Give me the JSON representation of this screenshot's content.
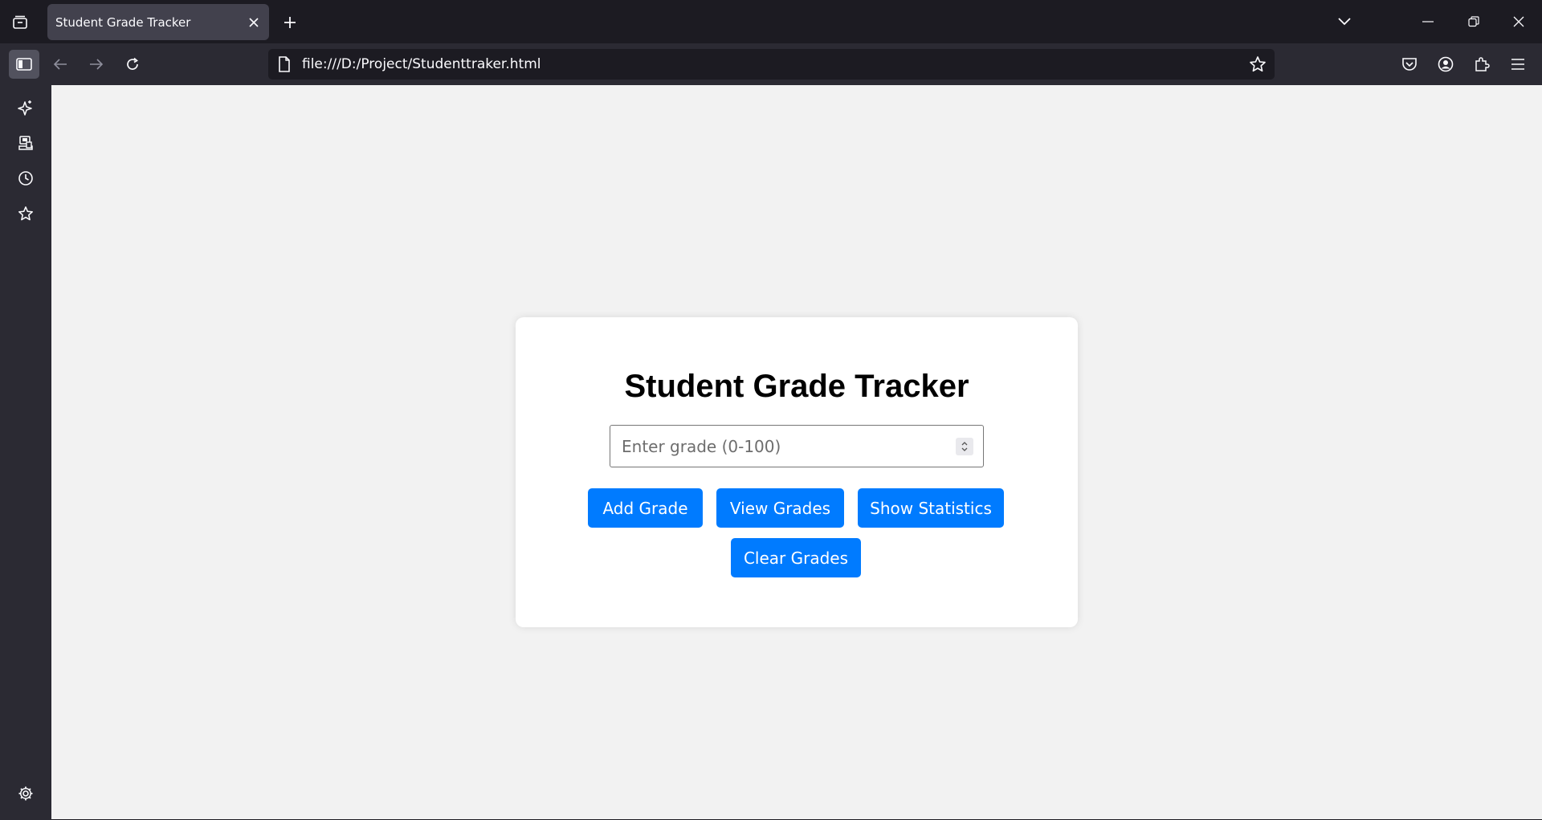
{
  "browser": {
    "tab_title": "Student Grade Tracker",
    "url": "file:///D:/Project/Studenttraker.html",
    "icons": {
      "tab_list": "tab-list-icon",
      "close_tab": "close-icon",
      "new_tab": "plus-icon",
      "list_all_tabs": "chevron-down-icon",
      "minimize": "minimize-icon",
      "restore": "restore-icon",
      "close_window": "close-icon",
      "sidebar": "sidebar-icon",
      "back": "back-arrow-icon",
      "forward": "forward-arrow-icon",
      "reload": "reload-icon",
      "page": "page-icon",
      "bookmark": "star-icon",
      "pocket": "pocket-icon",
      "account": "account-icon",
      "extensions": "puzzle-icon",
      "menu": "hamburger-menu-icon"
    }
  },
  "sidebar": {
    "items": [
      {
        "icon": "ai-sparkle-icon"
      },
      {
        "icon": "synced-tabs-icon"
      },
      {
        "icon": "history-icon"
      },
      {
        "icon": "bookmarks-star-icon"
      }
    ],
    "settings_icon": "gear-icon"
  },
  "app": {
    "title": "Student Grade Tracker",
    "grade_input": {
      "placeholder": "Enter grade (0-100)",
      "value": ""
    },
    "buttons": {
      "add": "Add Grade",
      "view": "View Grades",
      "stats": "Show Statistics",
      "clear": "Clear Grades"
    },
    "colors": {
      "primary": "#007bff",
      "background": "#f2f2f2",
      "card": "#ffffff"
    }
  }
}
